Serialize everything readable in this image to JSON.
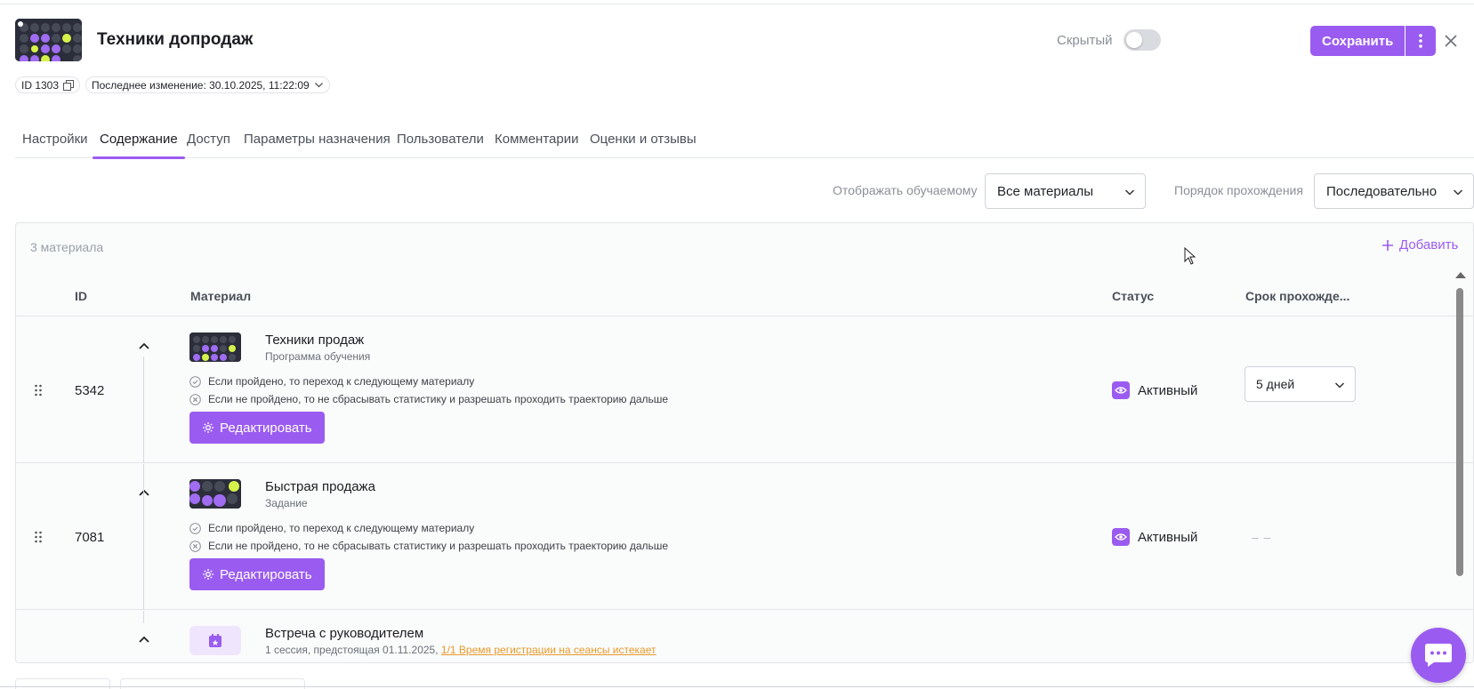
{
  "header": {
    "title": "Техники допродаж",
    "hidden_label": "Скрытый",
    "hidden_on": false,
    "save_label": "Сохранить",
    "id_chip": "ID 1303",
    "last_changed": "Последнее изменение: 30.10.2025, 11:22:09"
  },
  "tabs": [
    {
      "label": "Настройки",
      "active": false
    },
    {
      "label": "Содержание",
      "active": true
    },
    {
      "label": "Доступ",
      "active": false
    },
    {
      "label": "Параметры назначения",
      "active": false
    },
    {
      "label": "Пользователи",
      "active": false
    },
    {
      "label": "Комментарии",
      "active": false
    },
    {
      "label": "Оценки и отзывы",
      "active": false
    }
  ],
  "filters": {
    "display_label": "Отображать обучаемому",
    "display_value": "Все материалы",
    "order_label": "Порядок прохождения",
    "order_value": "Последовательно"
  },
  "table": {
    "count": "3 материала",
    "add_label": "Добавить",
    "columns": [
      "ID",
      "Материал",
      "Статус",
      "Срок прохожде..."
    ],
    "edit_label": "Редактировать",
    "rows": [
      {
        "id": "5342",
        "name": "Техники продаж",
        "type": "Программа обучения",
        "rule_pass": "Если пройдено, то переход к следующему материалу",
        "rule_fail": "Если не пройдено, то не сбрасывать статистику и разрешать проходить траекторию дальше",
        "status": "Активный",
        "deadline": "5 дней"
      },
      {
        "id": "7081",
        "name": "Быстрая продажа",
        "type": "Задание",
        "rule_pass": "Если пройдено, то переход к следующему материалу",
        "rule_fail": "Если не пройдено, то не сбрасывать статистику и разрешать проходить траекторию дальше",
        "status": "Активный",
        "deadline": "– –"
      },
      {
        "name": "Встреча с руководителем",
        "sub_prefix": "1 сессия, предстоящая 01.11.2025, ",
        "sub_link": "1/1 Время регистрации на сеансы истекает"
      }
    ]
  },
  "colors": {
    "accent": "#9a5cf0",
    "warning_link": "#e89a2a"
  }
}
